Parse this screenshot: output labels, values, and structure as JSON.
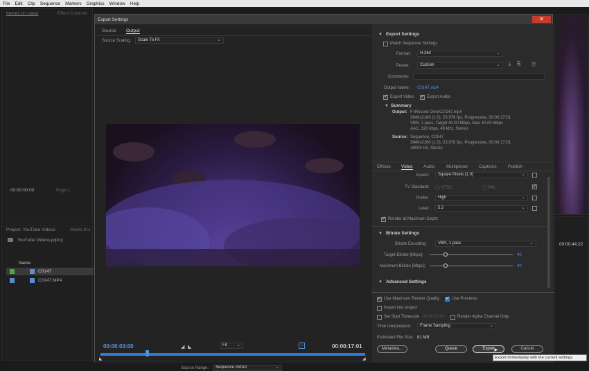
{
  "menu": [
    "File",
    "Edit",
    "Clip",
    "Sequence",
    "Markers",
    "Graphics",
    "Window",
    "Help"
  ],
  "bg": {
    "left_tab1": "Itemes (in state)",
    "left_tab2": "Effect Controls",
    "timecode": "00:00:00:00",
    "page": "Page 1",
    "project_tab": "Project: YouTube Videos",
    "media_tab": "Media Bro",
    "project_file": "YouTube Videos.prproj",
    "name_col": "Name",
    "items": [
      "C0147",
      "C0147.MP4"
    ],
    "right_timecode": "00:00:44:22"
  },
  "dialog": {
    "title": "Export Settings",
    "close": "✕",
    "tabs": [
      "Source",
      "Output"
    ],
    "source_scaling_label": "Source Scaling:",
    "source_scaling": "Scale To Fit",
    "timecode_in": "00:00:03:00",
    "timecode_out": "00:00:17:01",
    "fit": "Fit",
    "source_range_label": "Source Range:",
    "source_range": "Sequence In/Out",
    "export_settings": "Export Settings",
    "match_seq": "Match Sequence Settings",
    "format_label": "Format:",
    "format": "H.264",
    "preset_label": "Preset:",
    "preset": "Custom",
    "comments_label": "Comments:",
    "output_name_label": "Output Name:",
    "output_name": "C0147.mp4",
    "export_video": "Export Video",
    "export_audio": "Export Audio",
    "summary": "Summary",
    "output_label": "Output:",
    "output_lines": [
      "F:\\Record Drive\\C0147.mp4",
      "3840x2160 (1.0), 23.976 fps, Progressive, 00:00:17:01",
      "VBR, 1 pass, Target 40.00 Mbps, Max 40.00 Mbps",
      "AAC, 320 kbps, 48 kHz, Stereo"
    ],
    "source_label": "Source:",
    "source_lines": [
      "Sequence, C0147",
      "3840x2160 (1.0), 23.976 fps, Progressive, 00:00:17:01",
      "48000 Hz, Stereo"
    ],
    "settings_tabs": [
      "Effects",
      "Video",
      "Audio",
      "Multiplexer",
      "Captions",
      "Publish"
    ],
    "aspect_label": "Aspect:",
    "aspect": "Square Pixels (1.0)",
    "tv_label": "TV Standard:",
    "ntsc": "NTSC",
    "pal": "PAL",
    "profile_label": "Profile:",
    "profile": "High",
    "level_label": "Level:",
    "level": "5.2",
    "render_max_depth": "Render at Maximum Depth",
    "bitrate_settings": "Bitrate Settings",
    "bitrate_enc_label": "Bitrate Encoding:",
    "bitrate_enc": "VBR, 1 pass",
    "target_label": "Target Bitrate [Mbps]:",
    "target_val": "40",
    "max_label": "Maximum Bitrate [Mbps]:",
    "max_val": "40",
    "advanced": "Advanced Settings",
    "use_max_render": "Use Maximum Render Quality",
    "use_previews": "Use Previews",
    "import_project": "Import into project",
    "set_start_tc": "Set Start Timecode",
    "start_tc": "00;00;00;00",
    "render_alpha": "Render Alpha Channel Only",
    "interp_label": "Time Interpolation:",
    "interp": "Frame Sampling",
    "filesize_label": "Estimated File Size:",
    "filesize": "81 MB",
    "metadata": "Metadata...",
    "queue": "Queue",
    "export": "Export",
    "cancel": "Cancel",
    "tooltip": "Export immediately with the current settings"
  }
}
